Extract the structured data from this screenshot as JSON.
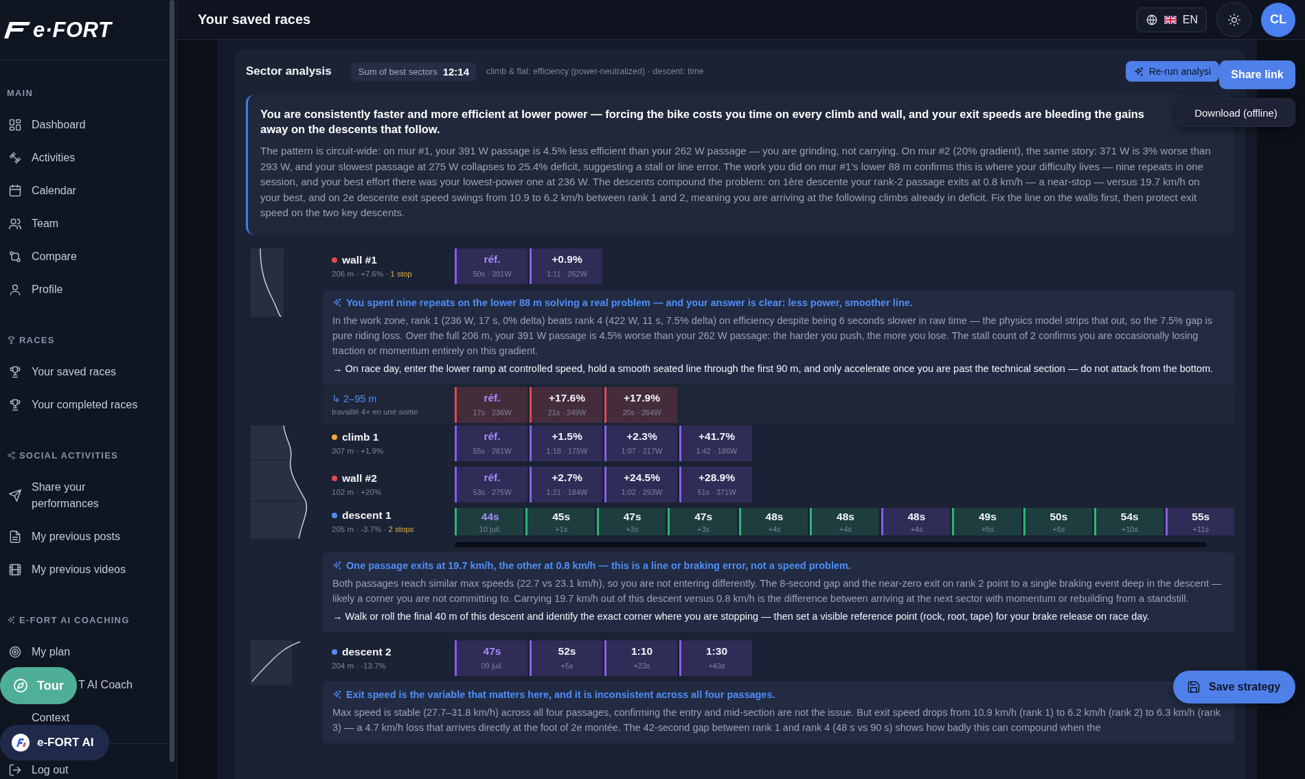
{
  "sidebar": {
    "logo": "e·FORT",
    "sections": [
      {
        "title": "MAIN",
        "items": [
          "Dashboard",
          "Activities",
          "Calendar",
          "Team",
          "Compare",
          "Profile"
        ]
      },
      {
        "title": "RACES",
        "items": [
          "Your saved races",
          "Your completed races"
        ]
      },
      {
        "title": "SOCIAL ACTIVITIES",
        "items": [
          "Share your performances",
          "My previous posts",
          "My previous videos"
        ]
      },
      {
        "title": "E-FORT AI COACHING",
        "items": [
          "My plan",
          "T AI Coach",
          "Context"
        ]
      }
    ],
    "logout": "Log out",
    "tour_button": "Tour",
    "assistant_button": "e-FORT AI"
  },
  "topbar": {
    "title": "Your saved races",
    "language": "EN",
    "avatar": "CL"
  },
  "analysis": {
    "title": "Sector analysis",
    "best_label": "Sum of best sectors",
    "best_value": "12:14",
    "note": "climb & flat: efficiency (power-neutralized) · descent: time",
    "rerun_button": "Re-run analysi",
    "share_button": "Share link",
    "download_button": "Download (offline)",
    "save_button": "Save strategy",
    "summary": {
      "headline": "You are consistently faster and more efficient at lower power — forcing the bike costs you time on every climb and wall, and your exit speeds are bleeding the gains away on the descents that follow.",
      "body": "The pattern is circuit-wide: on mur #1, your 391 W passage is 4.5% less efficient than your 262 W passage — you are grinding, not carrying. On mur #2 (20% gradient), the same story: 371 W is 3% worse than 293 W, and your slowest passage at 275 W collapses to 25.4% deficit, suggesting a stall or line error. The work you did on mur #1's lower 88 m confirms this is where your difficulty lives — nine repeats in one session, and your best effort there was your lowest-power one at 236 W. The descents compound the problem: on 1ère descente your rank-2 passage exits at 0.8 km/h — a near-stop — versus 19.7 km/h on your best, and on 2e descente exit speed swings from 10.9 to 6.2 km/h between rank 1 and 2, meaning you are arriving at the following climbs already in deficit. Fix the line on the walls first, then protect exit speed on the two key descents."
    },
    "groups": [
      {
        "sectors": [
          {
            "name": "wall #1",
            "color": "#e5484d",
            "meta": "206 m · +7.6% · ",
            "stops": "1 stop",
            "cells": [
              {
                "value": "réf.",
                "detail": "50s · 391W",
                "kind": "ref",
                "color": "#8b5cf6"
              },
              {
                "value": "+0.9%",
                "detail": "1:11 · 262W",
                "kind": "delta",
                "color": "#8b5cf6"
              }
            ],
            "insight": {
              "title": "You spent nine repeats on the lower 88 m solving a real problem — and your answer is clear: less power, smoother line.",
              "body": "In the work zone, rank 1 (236 W, 17 s, 0% delta) beats rank 4 (422 W, 11 s, 7.5% delta) on efficiency despite being 6 seconds slower in raw time — the physics model strips that out, so the 7.5% gap is pure riding loss. Over the full 206 m, your 391 W passage is 4.5% worse than your 262 W passage: the harder you push, the more you lose. The stall count of 2 confirms you are occasionally losing traction or momentum entirely on this gradient.",
              "action": "→ On race day, enter the lower ramp at controlled speed, hold a smooth seated line through the first 90 m, and only accelerate once you are past the technical section — do not attack from the bottom."
            },
            "subrows": [
              {
                "label": "↳ 2–95 m",
                "meta": "travaillé 4× en une sortie",
                "cells": [
                  {
                    "value": "réf.",
                    "detail": "17s · 236W",
                    "kind": "ref",
                    "color": "#e5484d"
                  },
                  {
                    "value": "+17.6%",
                    "detail": "21s · 249W",
                    "kind": "delta",
                    "color": "#e5484d"
                  },
                  {
                    "value": "+17.9%",
                    "detail": "20s · 264W",
                    "kind": "delta",
                    "color": "#e5484d"
                  }
                ]
              }
            ]
          }
        ]
      },
      {
        "sectors": [
          {
            "name": "climb 1",
            "color": "#f0a838",
            "meta": "307 m · +1.9%",
            "cells": [
              {
                "value": "réf.",
                "detail": "55s · 281W",
                "kind": "ref",
                "color": "#8b5cf6"
              },
              {
                "value": "+1.5%",
                "detail": "1:18 · 175W",
                "kind": "delta",
                "color": "#8b5cf6"
              },
              {
                "value": "+2.3%",
                "detail": "1:07 · 217W",
                "kind": "delta",
                "color": "#8b5cf6"
              },
              {
                "value": "+41.7%",
                "detail": "1:42 · 186W",
                "kind": "delta",
                "color": "#8b5cf6"
              }
            ]
          },
          {
            "name": "wall #2",
            "color": "#e5484d",
            "meta": "102 m · +20%",
            "cells": [
              {
                "value": "réf.",
                "detail": "53s · 275W",
                "kind": "ref",
                "color": "#8b5cf6"
              },
              {
                "value": "+2.7%",
                "detail": "1:21 · 184W",
                "kind": "delta",
                "color": "#8b5cf6"
              },
              {
                "value": "+24.5%",
                "detail": "1:02 · 293W",
                "kind": "delta",
                "color": "#8b5cf6"
              },
              {
                "value": "+28.9%",
                "detail": "51s · 371W",
                "kind": "delta",
                "color": "#8b5cf6"
              }
            ]
          },
          {
            "name": "descent 1",
            "color": "#4f8ef7",
            "meta": "205 m · -3.7% · ",
            "stops": "2 stops",
            "cells": [
              {
                "value": "44s",
                "detail": "10 juil.",
                "kind": "ref",
                "color": "#2bb673"
              },
              {
                "value": "45s",
                "detail": "+1s",
                "kind": "delta",
                "color": "#2bb673"
              },
              {
                "value": "47s",
                "detail": "+3s",
                "kind": "delta",
                "color": "#2bb673"
              },
              {
                "value": "47s",
                "detail": "+3s",
                "kind": "delta",
                "color": "#2bb673"
              },
              {
                "value": "48s",
                "detail": "+4s",
                "kind": "delta",
                "color": "#2bb673"
              },
              {
                "value": "48s",
                "detail": "+4s",
                "kind": "delta",
                "color": "#2bb673"
              },
              {
                "value": "48s",
                "detail": "+4s",
                "kind": "delta",
                "color": "#8b5cf6"
              },
              {
                "value": "49s",
                "detail": "+5s",
                "kind": "delta",
                "color": "#2bb673"
              },
              {
                "value": "50s",
                "detail": "+6s",
                "kind": "delta",
                "color": "#2bb673"
              },
              {
                "value": "54s",
                "detail": "+10s",
                "kind": "delta",
                "color": "#2bb673"
              },
              {
                "value": "55s",
                "detail": "+11s",
                "kind": "delta",
                "color": "#8b5cf6"
              }
            ],
            "insight": {
              "title": "One passage exits at 19.7 km/h, the other at 0.8 km/h — this is a line or braking error, not a speed problem.",
              "body": "Both passages reach similar max speeds (22.7 vs 23.1 km/h), so you are not entering differently. The 8-second gap and the near-zero exit on rank 2 point to a single braking event deep in the descent — likely a corner you are not committing to. Carrying 19.7 km/h out of this descent versus 0.8 km/h is the difference between arriving at the next sector with momentum or rebuilding from a standstill.",
              "action": "→ Walk or roll the final 40 m of this descent and identify the exact corner where you are stopping — then set a visible reference point (rock, root, tape) for your brake release on race day."
            }
          }
        ]
      },
      {
        "sectors": [
          {
            "name": "descent 2",
            "color": "#4f8ef7",
            "meta": "204 m · -13.7%",
            "cells": [
              {
                "value": "47s",
                "detail": "09 juil.",
                "kind": "ref",
                "color": "#8b5cf6"
              },
              {
                "value": "52s",
                "detail": "+5s",
                "kind": "delta",
                "color": "#8b5cf6"
              },
              {
                "value": "1:10",
                "detail": "+23s",
                "kind": "delta",
                "color": "#8b5cf6"
              },
              {
                "value": "1:30",
                "detail": "+43s",
                "kind": "delta",
                "color": "#8b5cf6"
              }
            ],
            "insight": {
              "title": "Exit speed is the variable that matters here, and it is inconsistent across all four passages.",
              "body": "Max speed is stable (27.7–31.8 km/h) across all four passages, confirming the entry and mid-section are not the issue. But exit speed drops from 10.9 km/h (rank 1) to 6.2 km/h (rank 2) to 6.3 km/h (rank 3) — a 4.7 km/h loss that arrives directly at the foot of 2e montée. The 42-second gap between rank 1 and rank 4 (48 s vs 90 s) shows how badly this can compound when the"
            }
          }
        ]
      }
    ]
  }
}
